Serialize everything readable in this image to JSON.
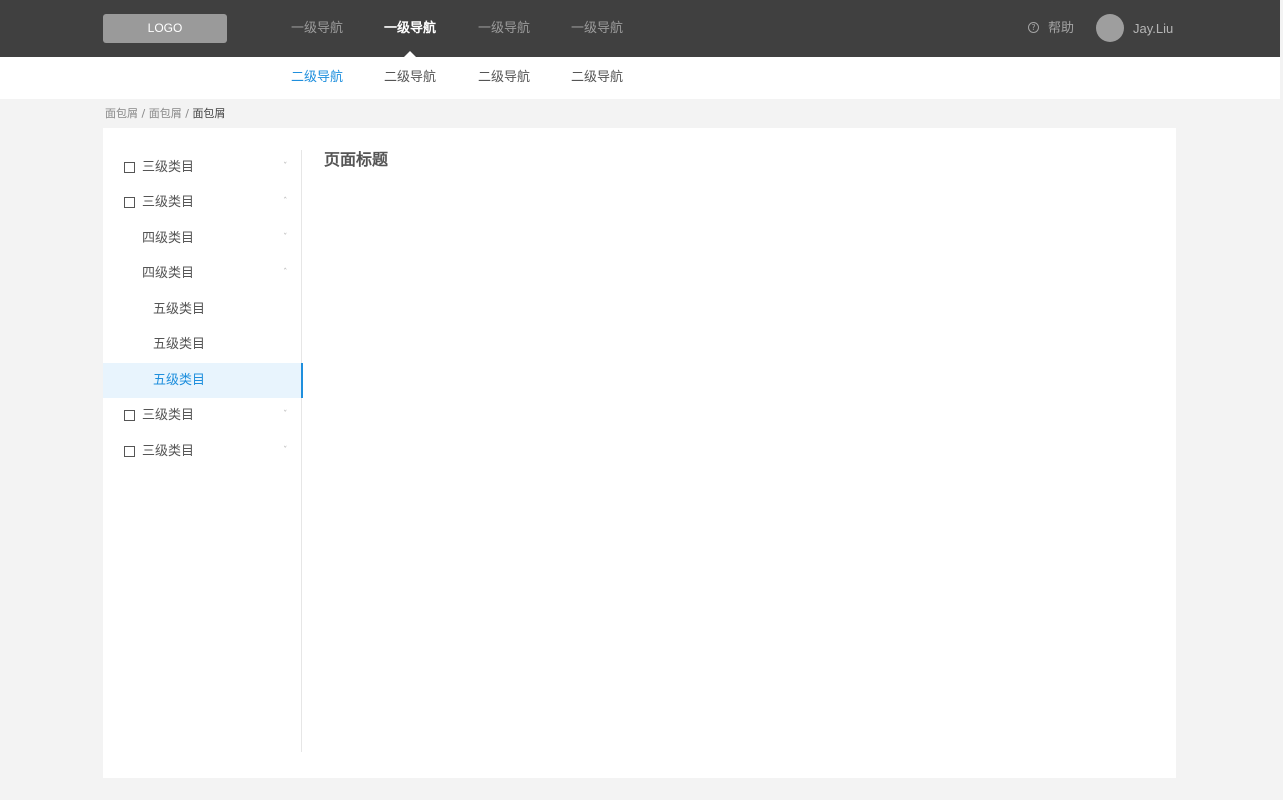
{
  "header": {
    "logo": "LOGO",
    "primary_nav": [
      {
        "label": "一级导航"
      },
      {
        "label": "一级导航"
      },
      {
        "label": "一级导航"
      },
      {
        "label": "一级导航"
      }
    ],
    "help_label": "帮助",
    "help_icon": "question-circle-icon",
    "username": "Jay.Liu"
  },
  "secondary_nav": [
    {
      "label": "二级导航"
    },
    {
      "label": "二级导航"
    },
    {
      "label": "二级导航"
    },
    {
      "label": "二级导航"
    }
  ],
  "breadcrumb": [
    "面包屑",
    "面包屑",
    "面包屑"
  ],
  "breadcrumb_separator": "/",
  "sidebar": {
    "items": [
      {
        "label": "三级类目",
        "chevron": "ˇ"
      },
      {
        "label": "三级类目",
        "chevron": "ˆ"
      },
      {
        "label": "四级类目",
        "chevron": "ˇ"
      },
      {
        "label": "四级类目",
        "chevron": "ˆ"
      },
      {
        "label": "五级类目"
      },
      {
        "label": "五级类目"
      },
      {
        "label": "五级类目"
      },
      {
        "label": "三级类目",
        "chevron": "ˇ"
      },
      {
        "label": "三级类目",
        "chevron": "ˇ"
      }
    ]
  },
  "page_title": "页面标题",
  "colors": {
    "topbar": "#404040",
    "accent": "#1f8fdd",
    "selected_bg": "#e8f4fd",
    "page_bg": "#f3f3f3"
  }
}
